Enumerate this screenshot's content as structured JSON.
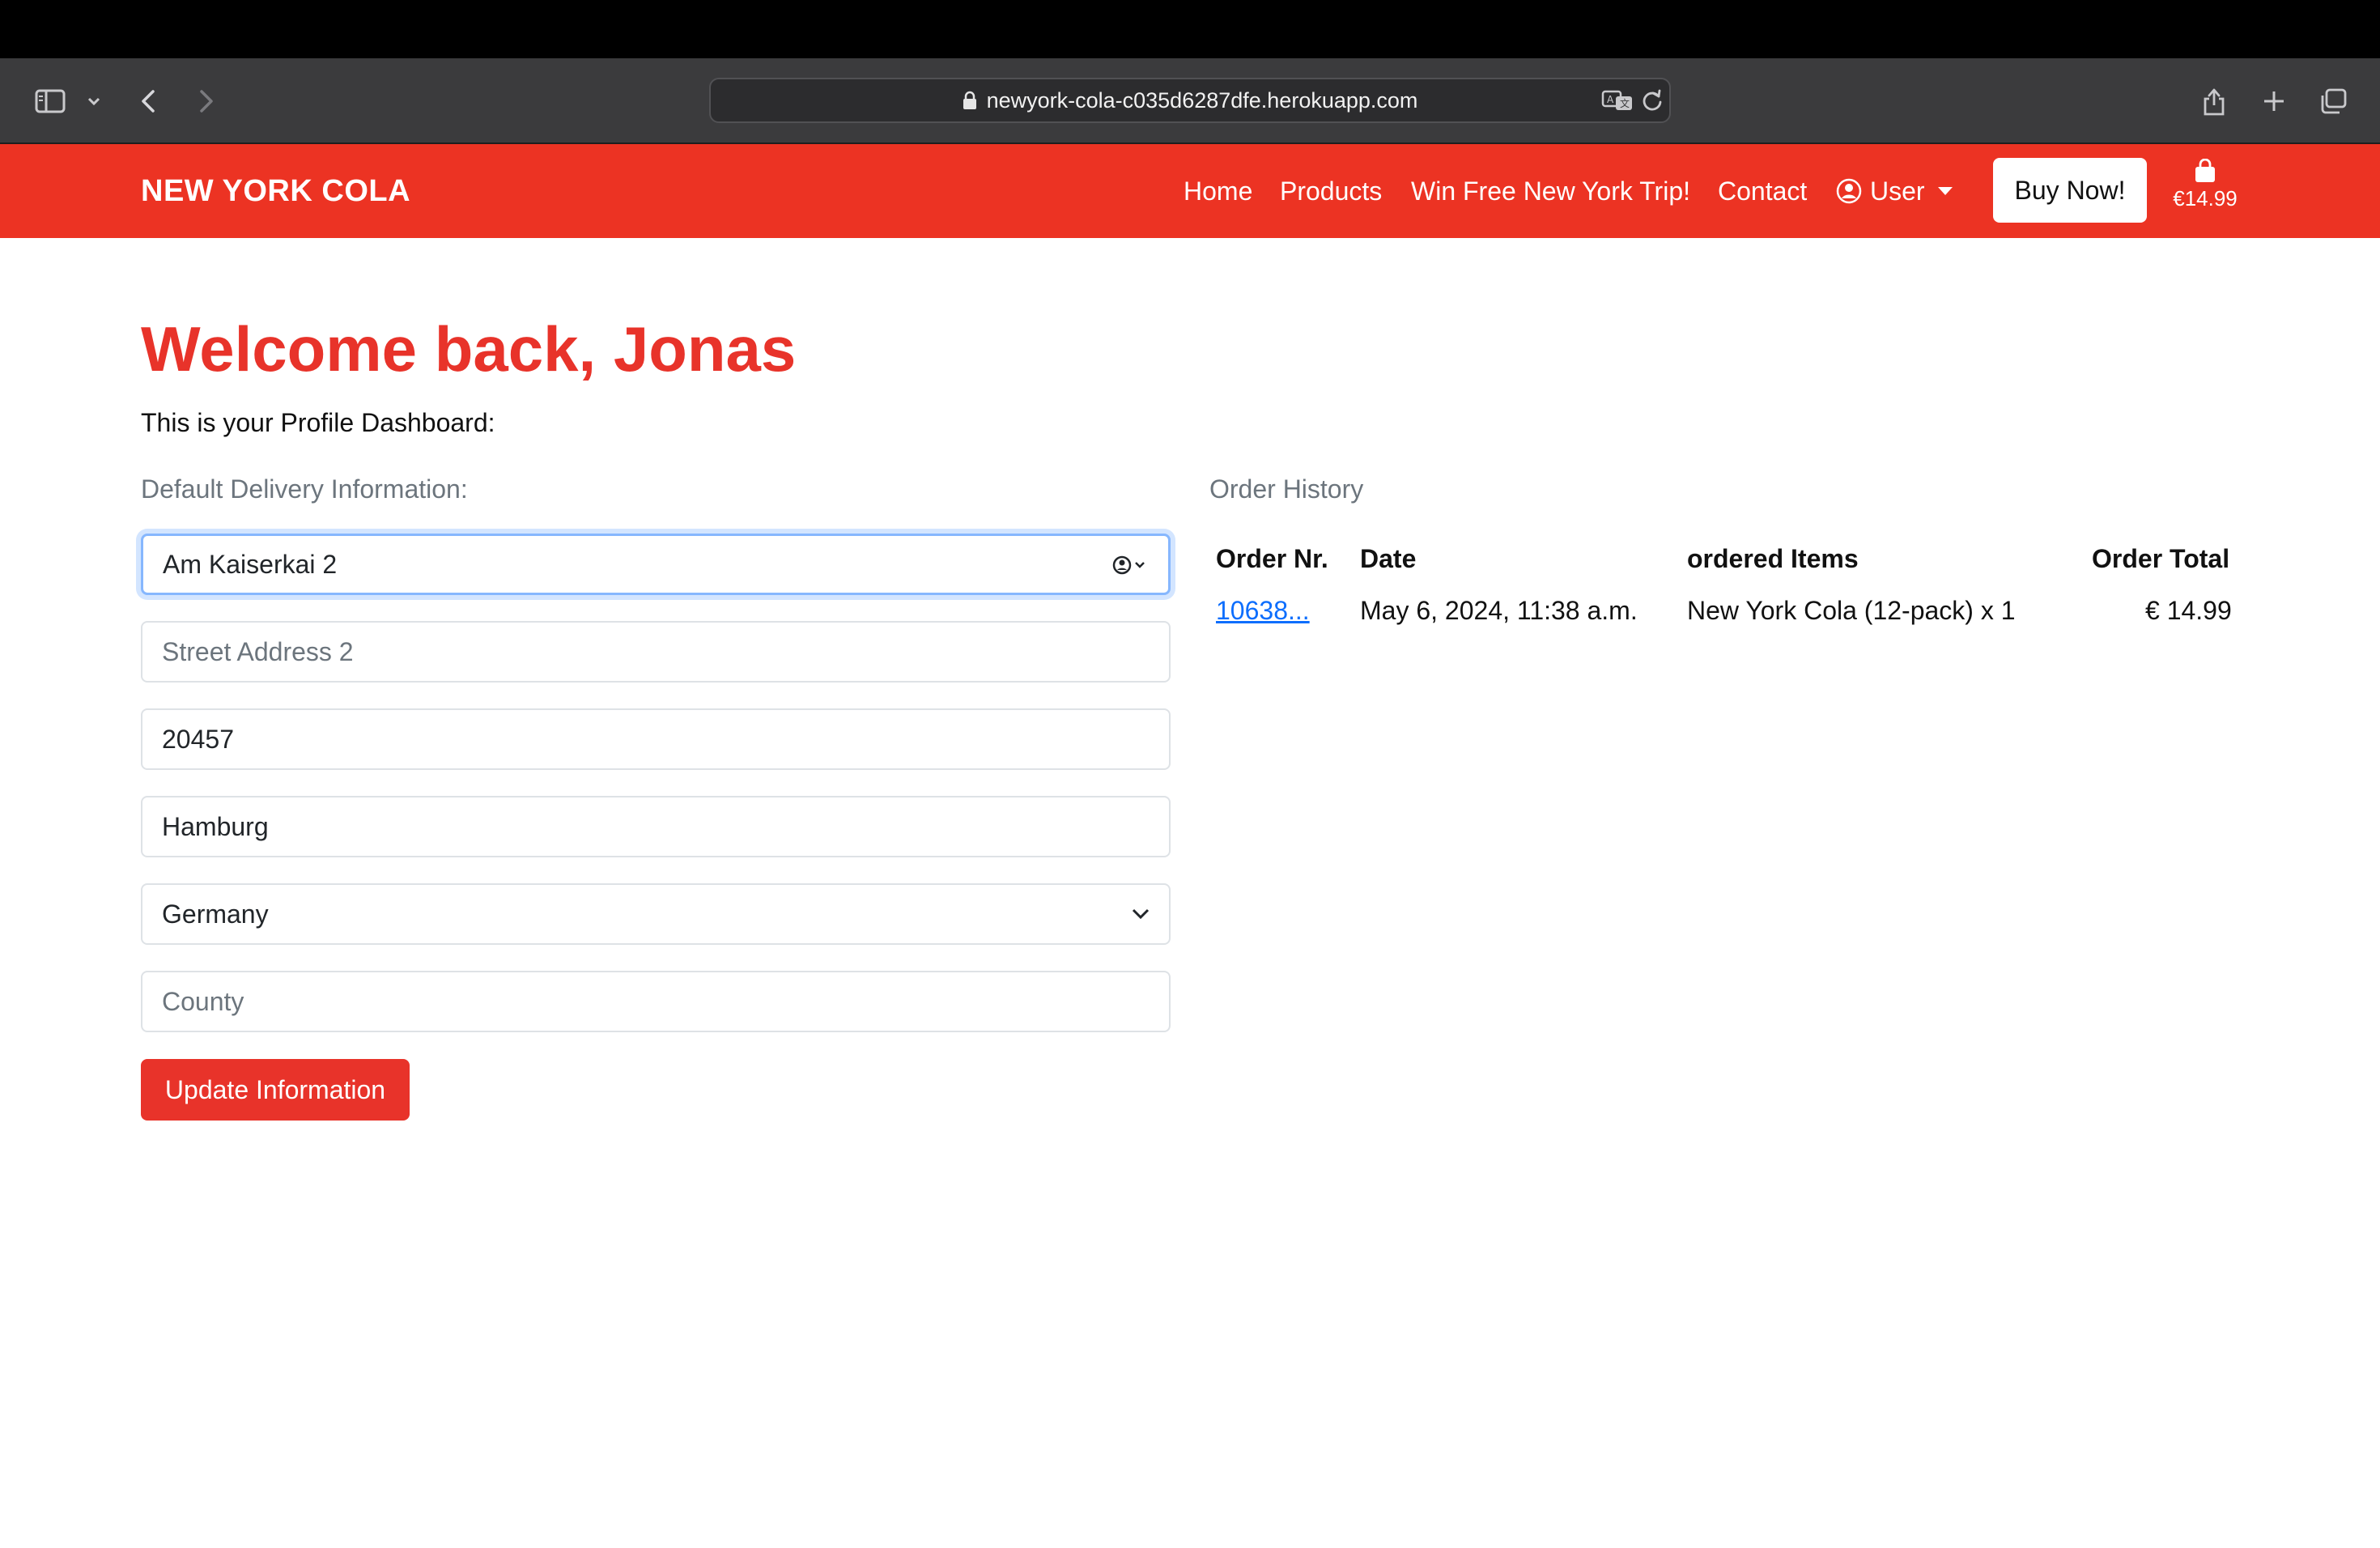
{
  "browser": {
    "url": "newyork-cola-c035d6287dfe.herokuapp.com",
    "icons": [
      "sidebar-icon",
      "chevron-down-icon",
      "back-icon",
      "forward-icon",
      "lock-icon",
      "translate-icon",
      "reload-icon",
      "share-icon",
      "new-tab-icon",
      "tabs-overview-icon"
    ]
  },
  "navbar": {
    "brand": "NEW YORK COLA",
    "links": {
      "home": "Home",
      "products": "Products",
      "win": "Win Free New York Trip!",
      "contact": "Contact",
      "user": "User"
    },
    "buy_now": "Buy Now!",
    "cart_total": "€14.99",
    "brand_color": "#ec3323"
  },
  "main": {
    "welcome": "Welcome back, Jonas",
    "subtitle": "This is your Profile Dashboard:",
    "delivery_label": "Default Delivery Information:",
    "form": {
      "street1_value": "Am Kaiserkai 2",
      "street2_placeholder": "Street Address 2",
      "postcode_value": "20457",
      "city_value": "Hamburg",
      "country_value": "Germany",
      "county_placeholder": "County",
      "update_button": "Update Information"
    },
    "orders": {
      "label": "Order History",
      "headers": [
        "Order Nr.",
        "Date",
        "ordered Items",
        "Order Total"
      ],
      "rows": [
        [
          "10638...",
          "May 6, 2024, 11:38 a.m.",
          "New York Cola (12-pack) x 1",
          "€ 14.99"
        ]
      ]
    }
  }
}
